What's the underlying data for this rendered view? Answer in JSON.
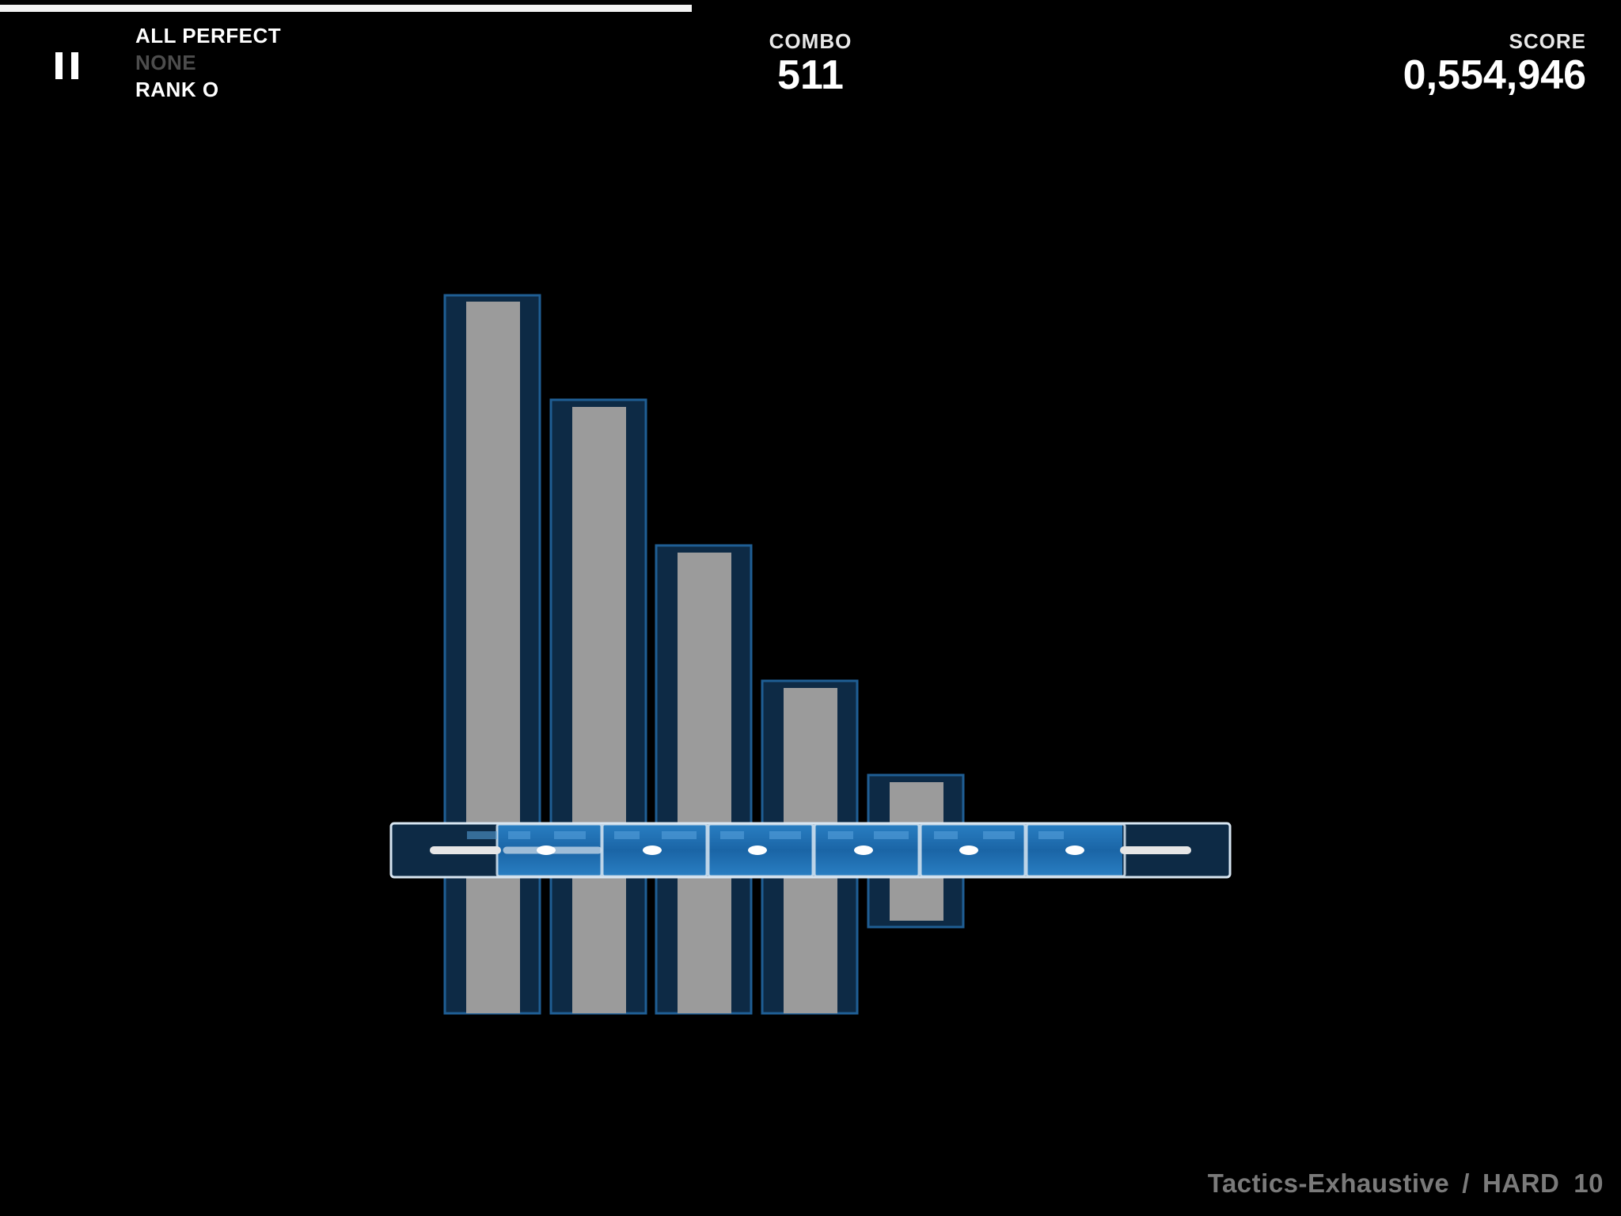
{
  "progress": {
    "fraction": 0.427
  },
  "hud": {
    "pause_icon": "pause-icon",
    "status_line1": "ALL PERFECT",
    "status_line2": "NONE",
    "status_line3": "RANK O",
    "combo_label": "COMBO",
    "combo_value": "511",
    "score_label": "SCORE",
    "score_value": "0,554,946"
  },
  "song": {
    "title": "Tactics-Exhaustive",
    "separator": "/",
    "difficulty": "HARD",
    "level": "10"
  },
  "colors": {
    "background": "#000000",
    "note_frame": "#0d2a45",
    "note_border": "#1f5e94",
    "note_inner": "#9b9b9b",
    "slide_body": "#1d6fb5",
    "slide_border": "#d8e6f2",
    "text_dim": "#4d4d4d",
    "song_info": "#7a7a7a"
  }
}
